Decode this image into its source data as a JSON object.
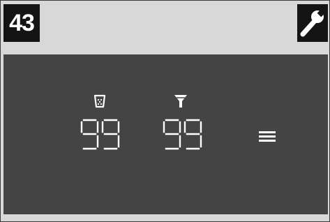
{
  "step": {
    "number": "43"
  },
  "header": {
    "tool_icon": "wrench-icon"
  },
  "display": {
    "cup_icon": "coffee-cup-icon",
    "filter_icon": "filter-icon",
    "cup_counter": "99",
    "filter_counter": "99",
    "menu_icon": "menu-icon"
  },
  "colors": {
    "badge_bg": "#141414",
    "panel_bg": "#d8d8d8",
    "display_bg": "#444444",
    "segment": "#ffffff"
  }
}
